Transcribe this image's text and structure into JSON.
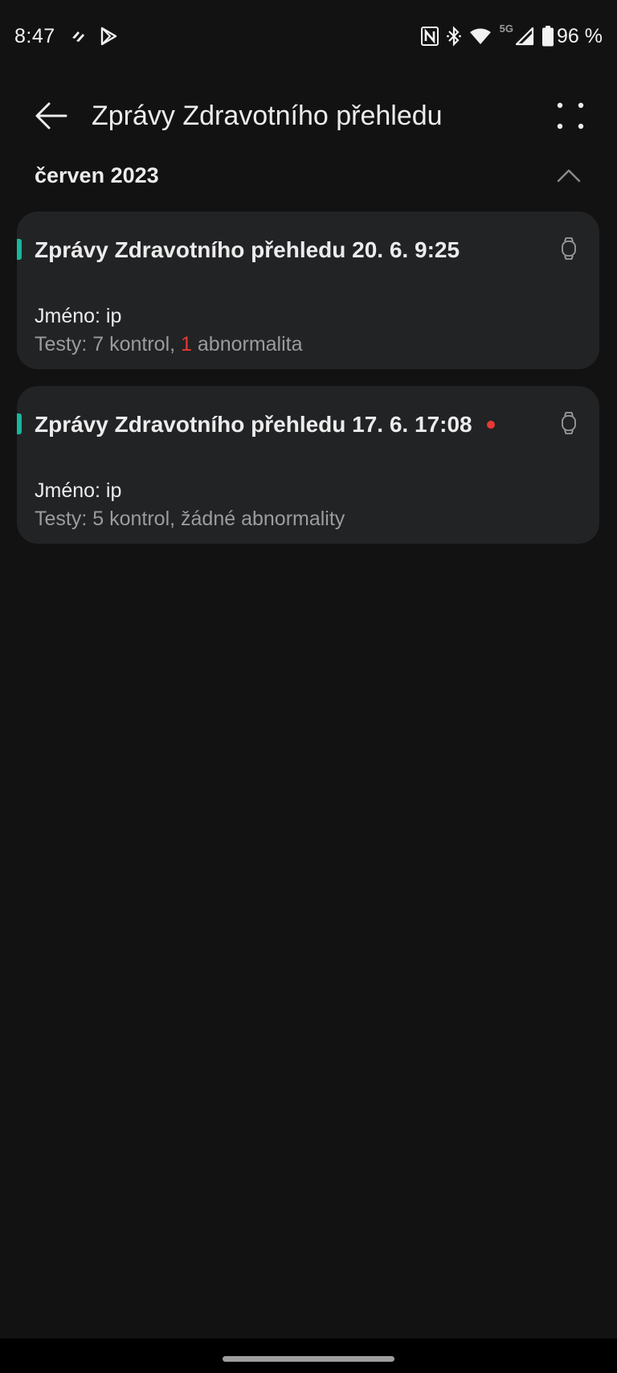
{
  "status_bar": {
    "time": "8:47",
    "network": "5G",
    "battery": "96 %",
    "icons": [
      "health-app-icon",
      "play-store-icon",
      "nfc-icon",
      "bluetooth-icon",
      "wifi-icon",
      "signal-icon",
      "battery-icon"
    ]
  },
  "header": {
    "title": "Zprávy Zdravotního přehledu",
    "back_icon": "arrow-left-icon",
    "more_icon": "more-icon"
  },
  "section": {
    "title": "červen 2023",
    "collapse_icon": "chevron-up-icon"
  },
  "reports": [
    {
      "title": "Zprávy Zdravotního přehledu 20. 6. 9:25",
      "unread": false,
      "name_line": "Jméno: ip",
      "tests_prefix": "Testy: 7 kontrol, ",
      "abnormal_count": "1",
      "tests_suffix": " abnormalita",
      "device_icon": "watch-icon"
    },
    {
      "title": "Zprávy Zdravotního přehledu 17. 6. 17:08",
      "unread": true,
      "name_line": "Jméno: ip",
      "tests_line": "Testy: 5 kontrol, žádné abnormality",
      "device_icon": "watch-icon"
    }
  ],
  "colors": {
    "background": "#121212",
    "card": "#222325",
    "accent": "#17b79b",
    "alert": "#e53935",
    "text_primary": "#ececec",
    "text_secondary": "#9c9c9c"
  }
}
